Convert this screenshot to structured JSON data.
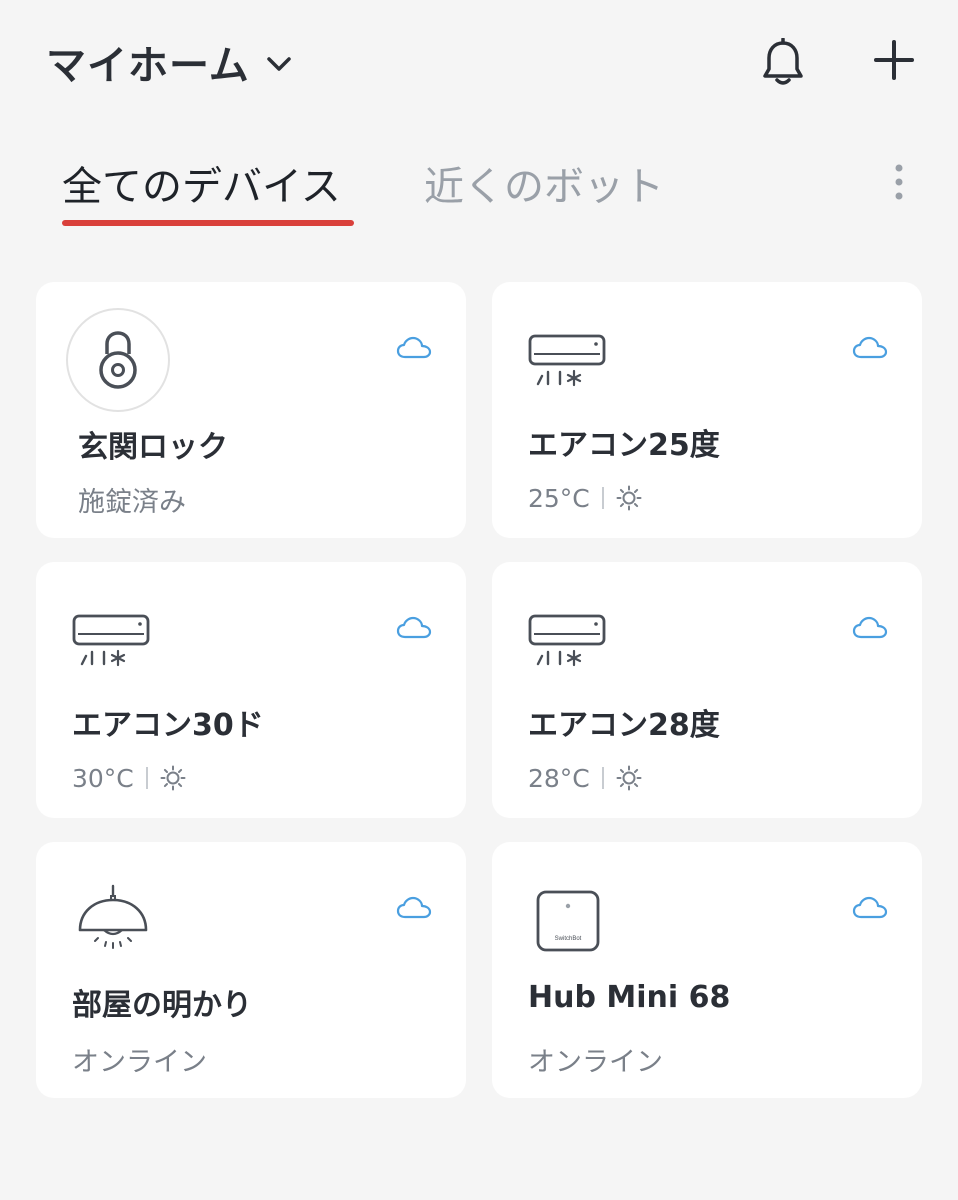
{
  "header": {
    "home_title": "マイホーム",
    "icons": [
      "chevron-down-icon",
      "bell-icon",
      "plus-icon"
    ]
  },
  "tabs": [
    {
      "label": "全てのデバイス",
      "active": true
    },
    {
      "label": "近くのボット",
      "active": false
    }
  ],
  "colors": {
    "accent": "#d9403b",
    "cloud": "#4a9fe0",
    "card_bg": "#ffffff",
    "page_bg": "#f5f5f5"
  },
  "devices": [
    {
      "name": "玄関ロック",
      "status": "施錠済み",
      "icon": "lock-icon"
    },
    {
      "name": "エアコン25度",
      "temp": "25°C",
      "mode_icon": "sun-icon",
      "icon": "air-conditioner-icon"
    },
    {
      "name": "エアコン30ド",
      "temp": "30°C",
      "mode_icon": "sun-icon",
      "icon": "air-conditioner-icon"
    },
    {
      "name": "エアコン28度",
      "temp": "28°C",
      "mode_icon": "sun-icon",
      "icon": "air-conditioner-icon"
    },
    {
      "name": "部屋の明かり",
      "status": "オンライン",
      "icon": "ceiling-lamp-icon"
    },
    {
      "name": "Hub Mini 68",
      "status": "オンライン",
      "icon": "hub-mini-icon",
      "hub_brand": "SwitchBot"
    }
  ]
}
